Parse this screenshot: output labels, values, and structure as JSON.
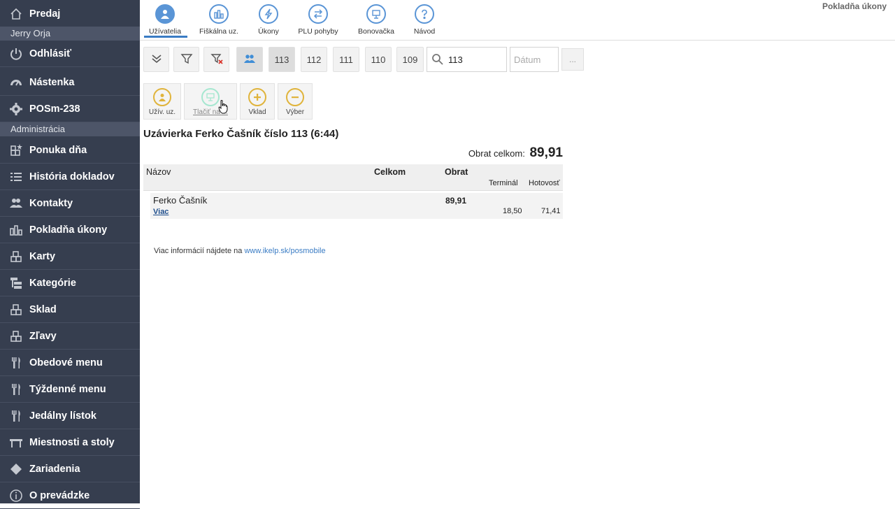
{
  "page_title": "Pokladňa úkony",
  "sidebar": {
    "top": {
      "label": "Predaj",
      "icon": "home-icon"
    },
    "user": "Jerry Orja",
    "logout": {
      "label": "Odhlásiť",
      "icon": "power-icon"
    },
    "dashboard": {
      "label": "Nástenka",
      "icon": "dashboard-icon"
    },
    "device": {
      "label": "POSm-238",
      "icon": "gear-icon"
    },
    "admin_section": "Administrácia",
    "items": [
      {
        "label": "Ponuka dňa",
        "icon": "blocks-star-icon"
      },
      {
        "label": "História dokladov",
        "icon": "list-icon"
      },
      {
        "label": "Kontakty",
        "icon": "users-icon"
      },
      {
        "label": "Pokladňa úkony",
        "icon": "bar-chart-icon"
      },
      {
        "label": "Karty",
        "icon": "blocks-icon"
      },
      {
        "label": "Kategórie",
        "icon": "tree-icon"
      },
      {
        "label": "Sklad",
        "icon": "blocks-icon"
      },
      {
        "label": "Zľavy",
        "icon": "blocks-icon"
      },
      {
        "label": "Obedové menu",
        "icon": "cutlery-icon"
      },
      {
        "label": "Týždenné menu",
        "icon": "cutlery-icon"
      },
      {
        "label": "Jedálny lístok",
        "icon": "cutlery-icon"
      },
      {
        "label": "Miestnosti a stoly",
        "icon": "table-icon"
      },
      {
        "label": "Zariadenia",
        "icon": "diamond-icon"
      },
      {
        "label": "O prevádzke",
        "icon": "info-icon"
      }
    ]
  },
  "tabs": [
    {
      "label": "Užívatelia",
      "icon": "user-icon",
      "active": true
    },
    {
      "label": "Fiškálna uz.",
      "icon": "bar-chart-icon"
    },
    {
      "label": "Úkony",
      "icon": "bolt-icon"
    },
    {
      "label": "PLU pohyby",
      "icon": "swap-icon"
    },
    {
      "label": "Bonovačka",
      "icon": "printer-icon"
    },
    {
      "label": "Návod",
      "icon": "help-icon"
    }
  ],
  "filters": {
    "numbers": [
      "113",
      "112",
      "111",
      "110",
      "109"
    ],
    "search_value": "113",
    "date_placeholder": "Dátum",
    "more_label": "..."
  },
  "actions": [
    {
      "label": "Užív. uz.",
      "icon": "user-icon"
    },
    {
      "label": "Tlačiť na ...",
      "icon": "printer-icon"
    },
    {
      "label": "Vklad",
      "icon": "plus-icon"
    },
    {
      "label": "Výber",
      "icon": "minus-icon"
    }
  ],
  "report": {
    "title": "Uzávierka Ferko Čašník číslo 113 (6:44)",
    "total_label": "Obrat celkom:",
    "total_value": "89,91",
    "columns": {
      "name": "Názov",
      "total": "Celkom",
      "turnover": "Obrat",
      "terminal": "Terminál",
      "cash": "Hotovosť"
    },
    "rows": [
      {
        "name": "Ferko Čašník",
        "link": "Viac",
        "turnover": "89,91",
        "terminal": "18,50",
        "cash": "71,41"
      }
    ]
  },
  "info": {
    "text": "Viac informácií nájdete na",
    "link": "www.ikelp.sk/posmobile"
  },
  "colors": {
    "sidebar": "#363e4f",
    "accent": "#5a95d6",
    "action": "#e0b43c"
  }
}
